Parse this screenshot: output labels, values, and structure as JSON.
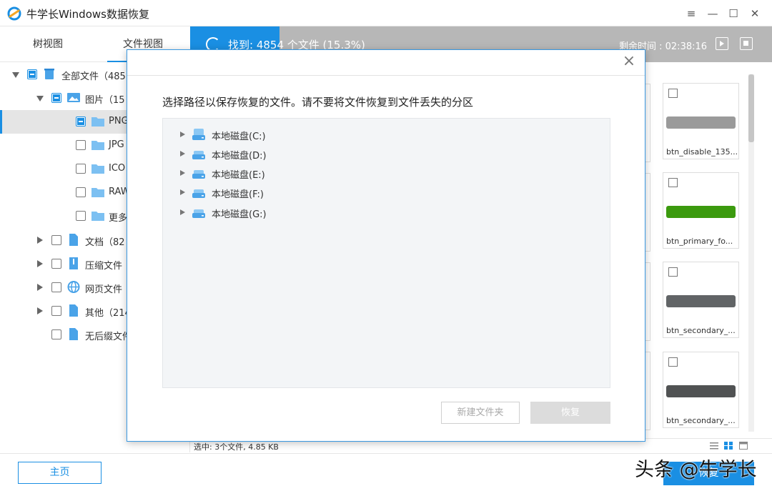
{
  "app": {
    "title": "牛学长Windows数据恢复"
  },
  "window_controls": {
    "menu": "≡",
    "minimize": "—",
    "maximize": "☐",
    "close": "✕"
  },
  "tabs": [
    {
      "label": "树视图"
    },
    {
      "label": "文件视图"
    }
  ],
  "scan": {
    "found_text": "找到: 4854 个文件 (15.3%)",
    "progress": 0.153,
    "remaining": "剩余时间 : 02:38:16"
  },
  "tree": {
    "items": [
      {
        "label": "全部文件（485"
      },
      {
        "label": "图片（15"
      },
      {
        "label": "PNG"
      },
      {
        "label": "JPG"
      },
      {
        "label": "ICO"
      },
      {
        "label": "RAW"
      },
      {
        "label": "更多"
      },
      {
        "label": "文档（82"
      },
      {
        "label": "压缩文件"
      },
      {
        "label": "网页文件"
      },
      {
        "label": "其他（214"
      },
      {
        "label": "无后缀文件"
      }
    ]
  },
  "thumbnails": [
    {
      "name": "btn_disable_135...",
      "color": "#9a9a9a"
    },
    {
      "name": "btn_primary_fo...",
      "color": "#3b9a0e"
    },
    {
      "name": "btn_secondary_...",
      "color": "#616466"
    },
    {
      "name": "btn_secondary_...",
      "color": "#505253"
    }
  ],
  "status": {
    "selected": "选中: 3个文件, 4.85 KB"
  },
  "footer": {
    "home": "主页",
    "recover": "恢复",
    "watermark": "头条 @牛学长"
  },
  "dialog": {
    "close": "×",
    "message": "选择路径以保存恢复的文件。请不要将文件恢复到文件丢失的分区",
    "drives": [
      {
        "label": "本地磁盘(C:)"
      },
      {
        "label": "本地磁盘(D:)"
      },
      {
        "label": "本地磁盘(E:)"
      },
      {
        "label": "本地磁盘(F:)"
      },
      {
        "label": "本地磁盘(G:)"
      }
    ],
    "new_folder": "新建文件夹",
    "recover": "恢复"
  },
  "colors": {
    "accent": "#1a8fe3",
    "progress_bg": "#b7b7b7"
  }
}
